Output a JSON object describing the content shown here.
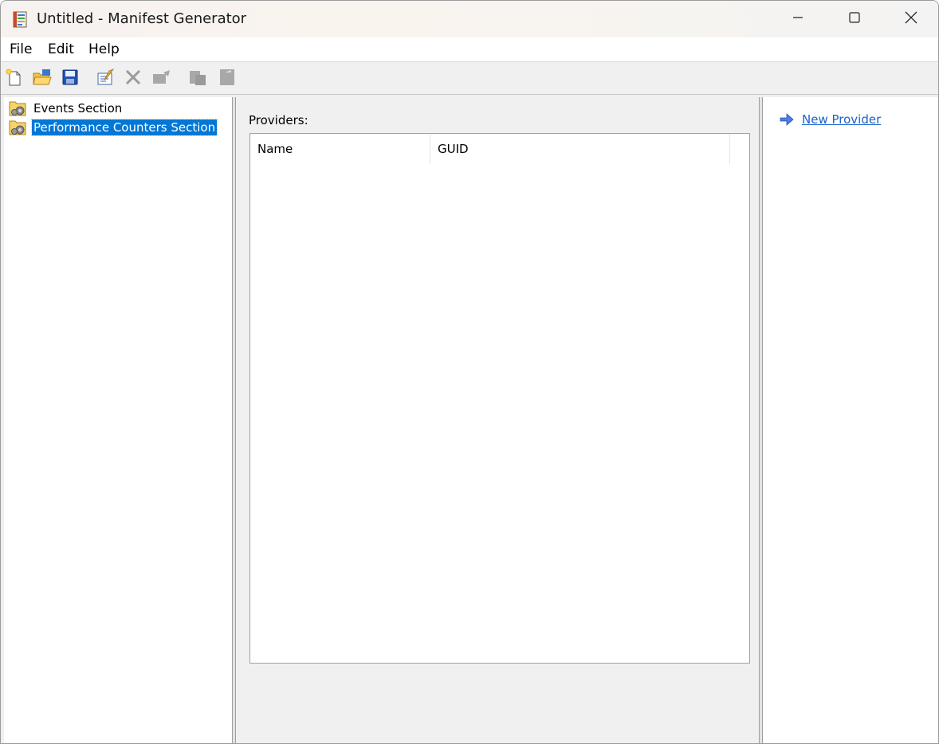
{
  "window": {
    "title": "Untitled - Manifest Generator",
    "icons": {
      "app": "manifest-generator-app-icon",
      "minimize": "minimize-icon",
      "maximize": "maximize-icon",
      "close": "close-icon"
    }
  },
  "menubar": {
    "items": [
      {
        "label": "File"
      },
      {
        "label": "Edit"
      },
      {
        "label": "Help"
      }
    ]
  },
  "toolbar": {
    "buttons": [
      {
        "icon": "new-document-icon",
        "enabled": true
      },
      {
        "icon": "open-folder-icon",
        "enabled": true
      },
      {
        "icon": "save-disk-icon",
        "enabled": true
      },
      {
        "icon": "edit-properties-icon",
        "enabled": true
      },
      {
        "icon": "delete-x-icon",
        "enabled": false
      },
      {
        "icon": "move-icon",
        "enabled": false
      },
      {
        "icon": "copy-icon",
        "enabled": false
      },
      {
        "icon": "paste-icon",
        "enabled": false
      }
    ]
  },
  "tree": {
    "items": [
      {
        "label": "Events Section",
        "icon": "folder-gear-icon",
        "selected": false
      },
      {
        "label": "Performance Counters Section",
        "icon": "folder-gear-icon",
        "selected": true
      }
    ]
  },
  "main": {
    "providers_label": "Providers:",
    "columns": [
      {
        "label": "Name"
      },
      {
        "label": "GUID"
      }
    ],
    "rows": []
  },
  "actions": {
    "items": [
      {
        "label": "New Provider",
        "icon": "blue-arrow-right-icon"
      }
    ]
  },
  "colors": {
    "selection": "#0078d7",
    "link": "#1a63c9",
    "chrome": "#f0f0f0"
  }
}
